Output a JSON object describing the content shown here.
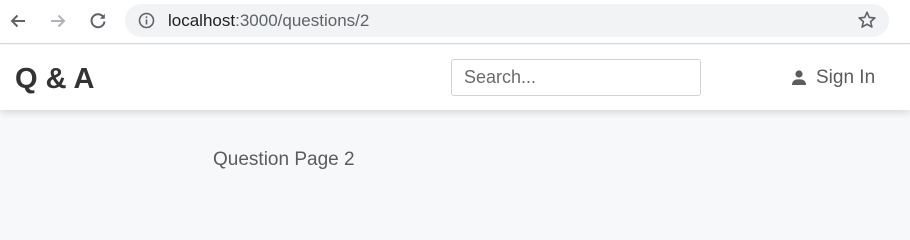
{
  "browser": {
    "url_host": "localhost",
    "url_path": ":3000/questions/2",
    "icons": {
      "back": "back-arrow-icon",
      "forward": "forward-arrow-icon",
      "reload": "reload-icon",
      "info": "info-icon",
      "bookmark": "star-icon"
    }
  },
  "header": {
    "logo": "Q & A",
    "search": {
      "placeholder": "Search...",
      "value": ""
    },
    "signin": {
      "label": "Sign In",
      "icon": "user-icon"
    }
  },
  "main": {
    "title": "Question Page 2"
  },
  "colors": {
    "chrome_bg": "#ffffff",
    "omnibox_bg": "#f1f3f4",
    "page_bg": "#f7f8fa",
    "logo_text": "#333333",
    "muted_text": "#5c5c5c"
  }
}
